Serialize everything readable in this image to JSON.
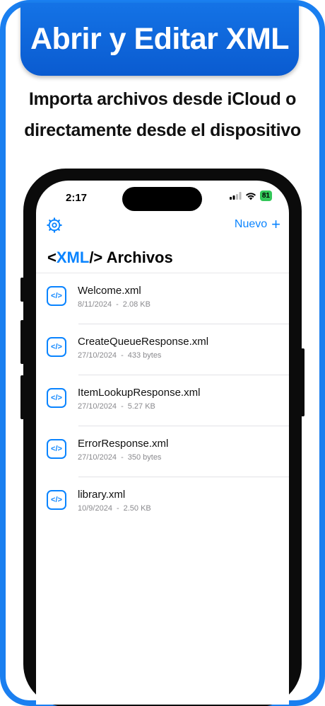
{
  "promo": {
    "headline": "Abrir y Editar XML",
    "subtitle_line1": "Importa archivos desde iCloud o",
    "subtitle_line2": "directamente desde el dispositivo"
  },
  "status_bar": {
    "time": "2:17",
    "battery": "81"
  },
  "nav": {
    "new_label": "Nuevo"
  },
  "header": {
    "open_bracket": "<",
    "xml": "XML",
    "close_bracket": "/>",
    "title": "Archivos"
  },
  "files": [
    {
      "name": "Welcome.xml",
      "date": "8/11/2024",
      "size": "2.08 KB"
    },
    {
      "name": "CreateQueueResponse.xml",
      "date": "27/10/2024",
      "size": "433 bytes"
    },
    {
      "name": "ItemLookupResponse.xml",
      "date": "27/10/2024",
      "size": "5.27 KB"
    },
    {
      "name": "ErrorResponse.xml",
      "date": "27/10/2024",
      "size": "350 bytes"
    },
    {
      "name": "library.xml",
      "date": "10/9/2024",
      "size": "2.50 KB"
    }
  ],
  "meta_separator": "-",
  "file_icon_glyph": "</>",
  "colors": {
    "accent": "#0a84ff",
    "frame": "#1a7ff0",
    "battery": "#33c759"
  }
}
